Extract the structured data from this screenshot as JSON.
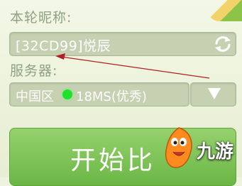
{
  "nickname": {
    "label": "本轮昵称:",
    "value": "[32CD99]悦辰"
  },
  "server": {
    "label": "服务器:",
    "region": "中国区",
    "ping": "18MS(优秀)",
    "status_color": "#1fe02a"
  },
  "start_button": {
    "label": "开始比"
  },
  "watermark": {
    "text": "九游"
  },
  "icons": [
    "refresh-icon",
    "dropdown-arrow-icon",
    "status-dot-icon"
  ]
}
